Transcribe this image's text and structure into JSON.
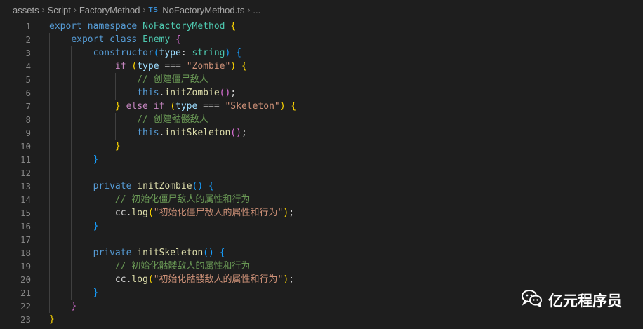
{
  "breadcrumb": {
    "items": [
      "assets",
      "Script",
      "FactoryMethod"
    ],
    "file_icon": "TS",
    "file_name": "NoFactoryMethod.ts",
    "trailing": "..."
  },
  "editor": {
    "lines": [
      [
        [
          "kw",
          "export "
        ],
        [
          "kw",
          "namespace "
        ],
        [
          "cls",
          "NoFactoryMethod "
        ],
        [
          "b1",
          "{"
        ]
      ],
      [
        [
          "plain",
          "    "
        ],
        [
          "kw",
          "export "
        ],
        [
          "kw",
          "class "
        ],
        [
          "cls",
          "Enemy "
        ],
        [
          "b2",
          "{"
        ]
      ],
      [
        [
          "plain",
          "        "
        ],
        [
          "kw",
          "constructor"
        ],
        [
          "b3",
          "("
        ],
        [
          "param",
          "type"
        ],
        [
          "plain",
          ": "
        ],
        [
          "cls",
          "string"
        ],
        [
          "b3",
          ")"
        ],
        [
          "plain",
          " "
        ],
        [
          "b3",
          "{"
        ]
      ],
      [
        [
          "plain",
          "            "
        ],
        [
          "ctrl",
          "if "
        ],
        [
          "b1",
          "("
        ],
        [
          "param",
          "type"
        ],
        [
          "plain",
          " === "
        ],
        [
          "str",
          "\"Zombie\""
        ],
        [
          "b1",
          ")"
        ],
        [
          "plain",
          " "
        ],
        [
          "b1",
          "{"
        ]
      ],
      [
        [
          "plain",
          "                "
        ],
        [
          "cmt",
          "// 创建僵尸敌人"
        ]
      ],
      [
        [
          "plain",
          "                "
        ],
        [
          "kw",
          "this"
        ],
        [
          "plain",
          "."
        ],
        [
          "fn",
          "initZombie"
        ],
        [
          "b2",
          "()"
        ],
        [
          "plain",
          ";"
        ]
      ],
      [
        [
          "plain",
          "            "
        ],
        [
          "b1",
          "}"
        ],
        [
          "plain",
          " "
        ],
        [
          "ctrl",
          "else if "
        ],
        [
          "b1",
          "("
        ],
        [
          "param",
          "type"
        ],
        [
          "plain",
          " === "
        ],
        [
          "str",
          "\"Skeleton\""
        ],
        [
          "b1",
          ")"
        ],
        [
          "plain",
          " "
        ],
        [
          "b1",
          "{"
        ]
      ],
      [
        [
          "plain",
          "                "
        ],
        [
          "cmt",
          "// 创建骷髅敌人"
        ]
      ],
      [
        [
          "plain",
          "                "
        ],
        [
          "kw",
          "this"
        ],
        [
          "plain",
          "."
        ],
        [
          "fn",
          "initSkeleton"
        ],
        [
          "b2",
          "()"
        ],
        [
          "plain",
          ";"
        ]
      ],
      [
        [
          "plain",
          "            "
        ],
        [
          "b1",
          "}"
        ]
      ],
      [
        [
          "plain",
          "        "
        ],
        [
          "b3",
          "}"
        ]
      ],
      [
        [
          "plain",
          ""
        ]
      ],
      [
        [
          "plain",
          "        "
        ],
        [
          "kw",
          "private "
        ],
        [
          "fn",
          "initZombie"
        ],
        [
          "b3",
          "()"
        ],
        [
          "plain",
          " "
        ],
        [
          "b3",
          "{"
        ]
      ],
      [
        [
          "plain",
          "            "
        ],
        [
          "cmt",
          "// 初始化僵尸敌人的属性和行为"
        ]
      ],
      [
        [
          "plain",
          "            "
        ],
        [
          "plain",
          "cc."
        ],
        [
          "fn",
          "log"
        ],
        [
          "b1",
          "("
        ],
        [
          "str",
          "\"初始化僵尸敌人的属性和行为\""
        ],
        [
          "b1",
          ")"
        ],
        [
          "plain",
          ";"
        ]
      ],
      [
        [
          "plain",
          "        "
        ],
        [
          "b3",
          "}"
        ]
      ],
      [
        [
          "plain",
          ""
        ]
      ],
      [
        [
          "plain",
          "        "
        ],
        [
          "kw",
          "private "
        ],
        [
          "fn",
          "initSkeleton"
        ],
        [
          "b3",
          "()"
        ],
        [
          "plain",
          " "
        ],
        [
          "b3",
          "{"
        ]
      ],
      [
        [
          "plain",
          "            "
        ],
        [
          "cmt",
          "// 初始化骷髅敌人的属性和行为"
        ]
      ],
      [
        [
          "plain",
          "            "
        ],
        [
          "plain",
          "cc."
        ],
        [
          "fn",
          "log"
        ],
        [
          "b1",
          "("
        ],
        [
          "str",
          "\"初始化骷髅敌人的属性和行为\""
        ],
        [
          "b1",
          ")"
        ],
        [
          "plain",
          ";"
        ]
      ],
      [
        [
          "plain",
          "        "
        ],
        [
          "b3",
          "}"
        ]
      ],
      [
        [
          "plain",
          "    "
        ],
        [
          "b2",
          "}"
        ]
      ],
      [
        [
          "b1",
          "}"
        ]
      ]
    ]
  },
  "watermark": {
    "icon": "wechat-icon",
    "text": "亿元程序员"
  }
}
